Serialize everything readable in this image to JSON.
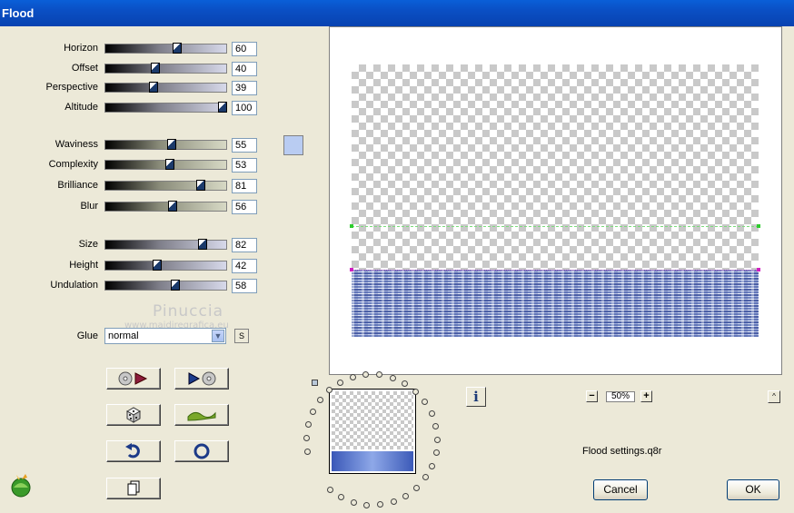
{
  "window": {
    "title": "Flood"
  },
  "params": [
    {
      "key": "horizon",
      "label": "Horizon",
      "value": "60",
      "level": 0.6
    },
    {
      "key": "offset",
      "label": "Offset",
      "value": "40",
      "level": 0.4
    },
    {
      "key": "perspective",
      "label": "Perspective",
      "value": "39",
      "level": 0.39
    },
    {
      "key": "altitude",
      "label": "Altitude",
      "value": "100",
      "level": 1.0
    },
    {
      "key": "waviness",
      "label": "Waviness",
      "value": "55",
      "level": 0.55
    },
    {
      "key": "complexity",
      "label": "Complexity",
      "value": "53",
      "level": 0.53
    },
    {
      "key": "brilliance",
      "label": "Brilliance",
      "value": "81",
      "level": 0.81
    },
    {
      "key": "blur",
      "label": "Blur",
      "value": "56",
      "level": 0.56
    },
    {
      "key": "size",
      "label": "Size",
      "value": "82",
      "level": 0.82
    },
    {
      "key": "height",
      "label": "Height",
      "value": "42",
      "level": 0.42
    },
    {
      "key": "undulation",
      "label": "Undulation",
      "value": "58",
      "level": 0.58
    }
  ],
  "watermark": {
    "name": "Pinuccia",
    "url": "www.maidiregrafica.eu"
  },
  "glue": {
    "label": "Glue",
    "value": "normal",
    "swap_label": "S"
  },
  "colors": {
    "water_color": "#b9ccf2",
    "title_bar": "#0a50c8"
  },
  "icons": {
    "rewind": "rewind-icon",
    "play": "play-icon",
    "dice": "dice-icon",
    "wave": "wave-icon",
    "undo": "undo-icon",
    "reset": "reset-icon",
    "copy": "copy-icon",
    "info": "info-icon",
    "logo": "logo-icon"
  },
  "zoom": {
    "value": "50%",
    "minus": "−",
    "plus": "+"
  },
  "settings_file": "Flood settings.q8r",
  "buttons": {
    "cancel": "Cancel",
    "ok": "OK",
    "up": "^",
    "info": "i"
  }
}
